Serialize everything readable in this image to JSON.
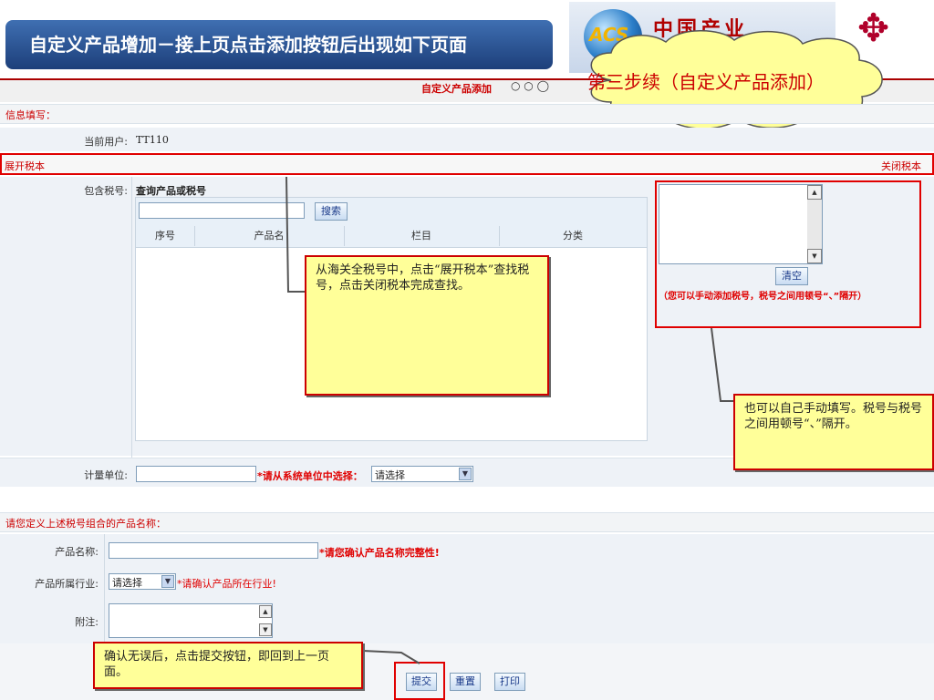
{
  "slide": {
    "title": "自定义产品增加－接上页点击添加按钮后出现如下页面",
    "logo_acs": "ACS",
    "logo_text": "中国产业",
    "cloud_text": "第三步续（自定义产品添加）"
  },
  "app": {
    "page_title": "自定义产品添加",
    "dots": "○ ○ ◯",
    "info_section": "信息填写：",
    "current_user_label": "当前用户:",
    "current_user_value": "TT110",
    "expand_tax": "展开税本",
    "close_tax": "关闭税本",
    "tax_label": "包含税号:",
    "query_title": "查询产品或税号",
    "search_value": "",
    "search_button": "搜索",
    "table_headers": [
      "序号",
      "产品名",
      "栏目",
      "分类"
    ],
    "clear_button": "清空",
    "tax_hint": "（您可以手动添加税号，税号之间用顿号“、”隔开）",
    "unit_label": "计量单位:",
    "unit_value": "",
    "unit_hint": "*请从系统单位中选择：",
    "unit_select": "请选择",
    "define_section": "请您定义上述税号组合的产品名称：",
    "product_name_label": "产品名称:",
    "product_name_value": "",
    "product_name_hint": "*请您确认产品名称完整性!",
    "industry_label": "产品所属行业:",
    "industry_select": "请选择",
    "industry_hint": "*请确认产品所在行业!",
    "note_label": "附注:",
    "submit_button": "提交",
    "reset_button": "重置",
    "print_button": "打印"
  },
  "callouts": {
    "c1": "从海关全税号中，点击“展开税本”查找税号，点击关闭税本完成查找。",
    "c2": "也可以自己手动填写。税号与税号之间用顿号“、”隔开。",
    "c3": "确认无误后，点击提交按钮，即回到上一页面。"
  },
  "colors": {
    "accent_red": "#e00000",
    "title_blue": "#1d3f7a",
    "callout_yellow": "#ffff99"
  }
}
